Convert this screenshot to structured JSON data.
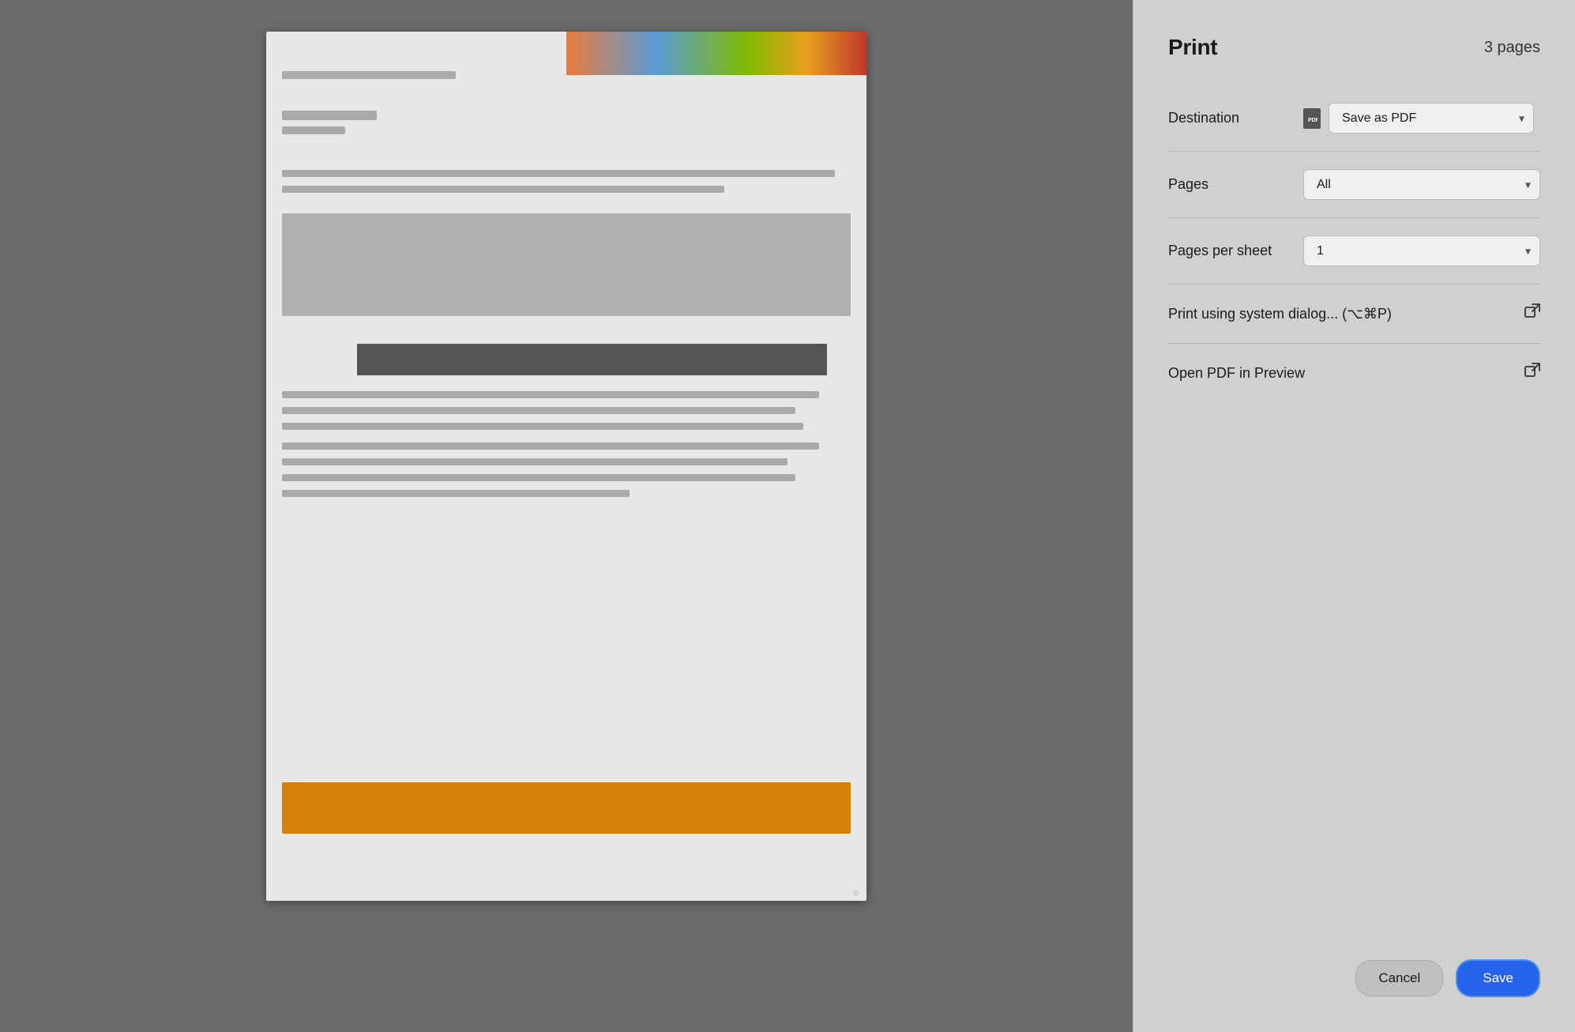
{
  "panel": {
    "title": "Print",
    "page_count": "3 pages",
    "destination_label": "Destination",
    "destination_value": "Save as PDF",
    "pages_label": "Pages",
    "pages_value": "All",
    "pages_per_sheet_label": "Pages per sheet",
    "pages_per_sheet_value": "1",
    "system_dialog_label": "Print using system dialog... (⌥⌘P)",
    "open_pdf_label": "Open PDF in Preview",
    "cancel_label": "Cancel",
    "save_label": "Save"
  },
  "preview": {
    "watermark": "©"
  }
}
